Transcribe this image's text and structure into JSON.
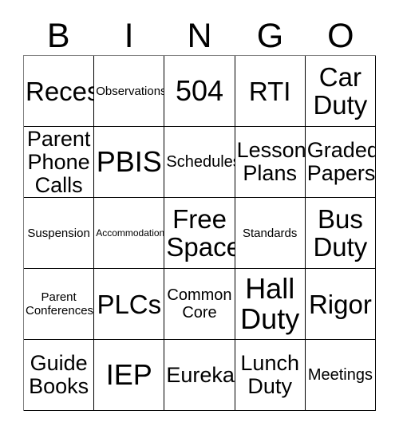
{
  "header": {
    "letters": [
      "B",
      "I",
      "N",
      "G",
      "O"
    ]
  },
  "grid": {
    "rows": 5,
    "columns": 5,
    "cells": [
      {
        "text": "Recess",
        "size": "lg"
      },
      {
        "text": "Observations",
        "size": "xs"
      },
      {
        "text": "504",
        "size": "xl"
      },
      {
        "text": "RTI",
        "size": "lg"
      },
      {
        "text": "Car\nDuty",
        "size": "lg"
      },
      {
        "text": "Parent\nPhone\nCalls",
        "size": "md"
      },
      {
        "text": "PBIS",
        "size": "xl"
      },
      {
        "text": "Schedules",
        "size": "sm"
      },
      {
        "text": "Lesson\nPlans",
        "size": "md"
      },
      {
        "text": "Graded\nPapers",
        "size": "md"
      },
      {
        "text": "Suspension",
        "size": "xs"
      },
      {
        "text": "Accommodations",
        "size": "xxs"
      },
      {
        "text": "Free\nSpace",
        "size": "lg"
      },
      {
        "text": "Standards",
        "size": "xs"
      },
      {
        "text": "Bus\nDuty",
        "size": "lg"
      },
      {
        "text": "Parent\nConferences",
        "size": "xs"
      },
      {
        "text": "PLCs",
        "size": "lg"
      },
      {
        "text": "Common\nCore",
        "size": "sm"
      },
      {
        "text": "Hall\nDuty",
        "size": "xl"
      },
      {
        "text": "Rigor",
        "size": "lg"
      },
      {
        "text": "Guide\nBooks",
        "size": "md"
      },
      {
        "text": "IEP",
        "size": "xl"
      },
      {
        "text": "Eureka",
        "size": "md"
      },
      {
        "text": "Lunch\nDuty",
        "size": "md"
      },
      {
        "text": "Meetings",
        "size": "sm"
      }
    ]
  },
  "colors": {
    "background": "#ffffff",
    "text": "#000000",
    "border": "#000000",
    "outer_border": "#808080"
  }
}
